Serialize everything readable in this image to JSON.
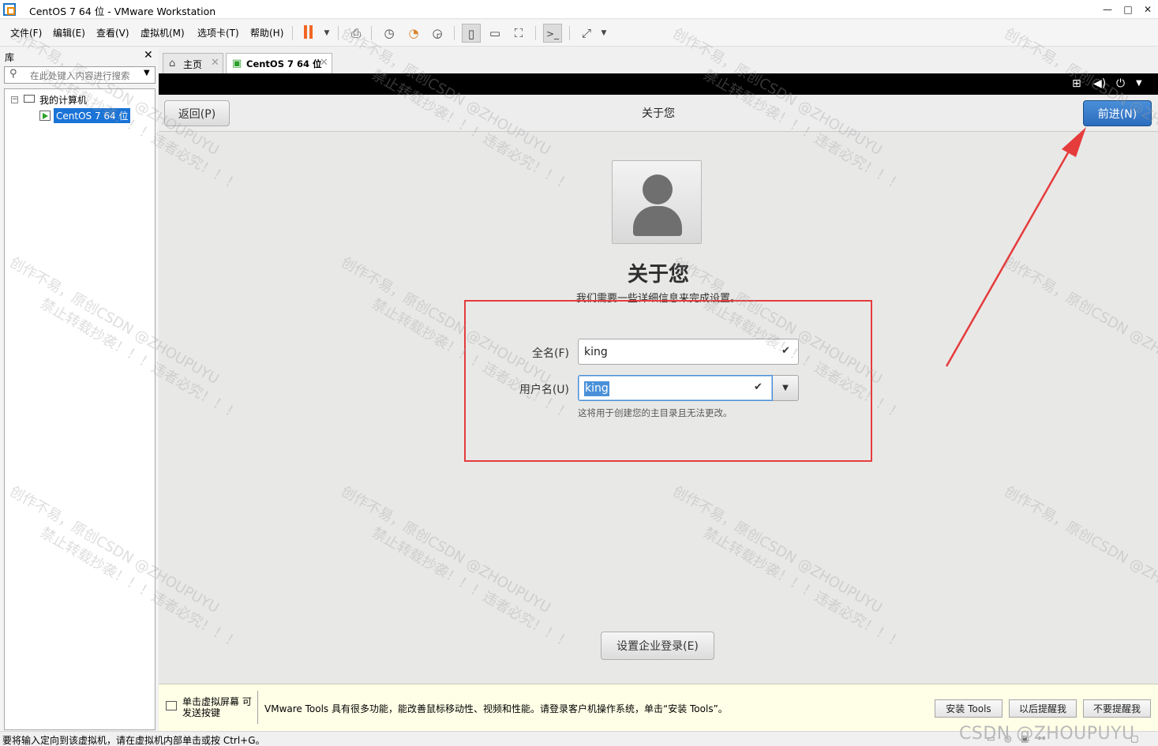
{
  "window": {
    "title": "CentOS 7 64 位 - VMware Workstation",
    "minimize": "—",
    "maximize": "□",
    "close": "✕"
  },
  "menu": [
    "文件(F)",
    "编辑(E)",
    "查看(V)",
    "虚拟机(M)",
    "选项卡(T)",
    "帮助(H)"
  ],
  "library": {
    "title": "库",
    "close": "✕",
    "search_placeholder": "在此处键入内容进行搜索",
    "tree_root": "我的计算机",
    "tree_vm": "CentOS 7 64 位"
  },
  "tabs": [
    {
      "label": "主页",
      "active": false
    },
    {
      "label": "CentOS 7 64 位",
      "active": true
    }
  ],
  "installer": {
    "back_label": "返回(P)",
    "header_title": "关于您",
    "next_label": "前进(N)",
    "heading": "关于您",
    "subtitle": "我们需要一些详细信息来完成设置。",
    "fullname_label": "全名(F)",
    "fullname_value": "king",
    "username_label": "用户名(U)",
    "username_value": "king",
    "username_hint": "这将用于创建您的主目录且无法更改。",
    "enterprise_label": "设置企业登录(E)",
    "check_glyph": "✔"
  },
  "hintbar": {
    "left_text": "单击虚拟屏幕 可发送按键",
    "message": "VMware Tools 具有很多功能，能改善鼠标移动性、视频和性能。请登录客户机操作系统，单击“安装 Tools”。",
    "install_tools": "安装 Tools",
    "remind_later": "以后提醒我",
    "never_remind": "不要提醒我"
  },
  "status": {
    "text": "要将输入定向到该虚拟机，请在虚拟机内部单击或按 Ctrl+G。",
    "watermark": "CSDN @ZHOUPUYU"
  },
  "watermark": {
    "line1": "创作不易，原创CSDN @ZHOUPUYU",
    "line2": "禁止转载抄袭！！！违者必究！！！"
  },
  "colors": {
    "accent_blue": "#2c6cbd",
    "annotation_red": "#e53c3c",
    "pause_orange": "#f26522"
  }
}
